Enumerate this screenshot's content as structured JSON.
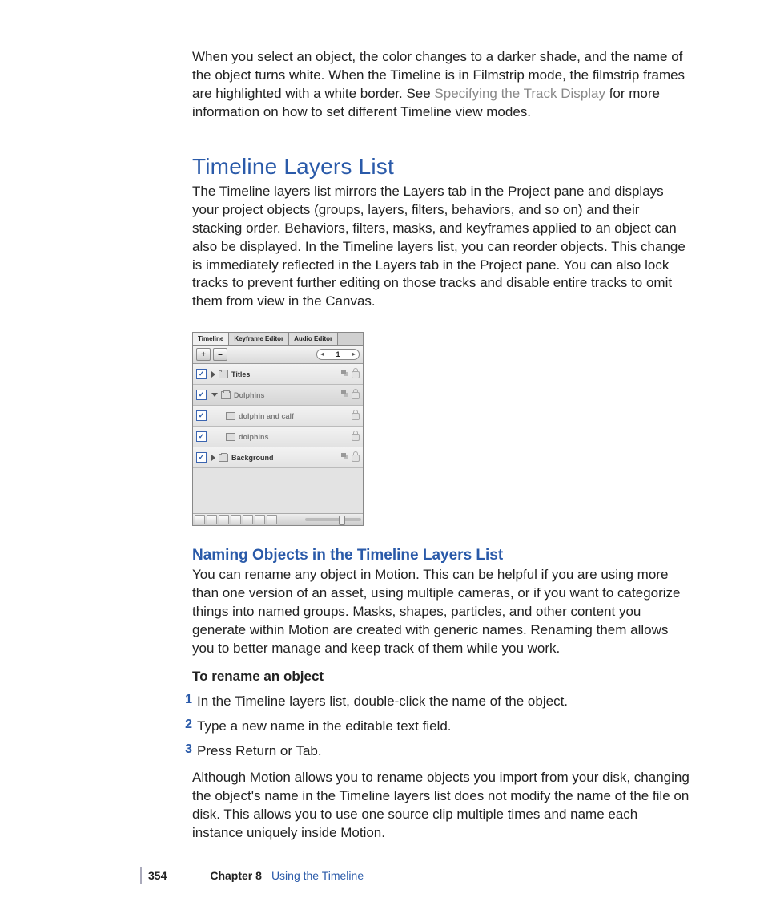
{
  "intro_para_pre": "When you select an object, the color changes to a darker shade, and the name of the object turns white. When the Timeline is in Filmstrip mode, the filmstrip frames are highlighted with a white border. See ",
  "intro_link": "Specifying the Track Display",
  "intro_para_post": " for more information on how to set different Timeline view modes.",
  "h1": "Timeline Layers List",
  "h1_para": "The Timeline layers list mirrors the Layers tab in the Project pane and displays your project objects (groups, layers, filters, behaviors, and so on) and their stacking order. Behaviors, filters, masks, and keyframes applied to an object can also be displayed. In the Timeline layers list, you can reorder objects. This change is immediately reflected in the Layers tab in the Project pane. You can also lock tracks to prevent further editing on those tracks and disable entire tracks to omit them from view in the Canvas.",
  "figure": {
    "tabs": [
      "Timeline",
      "Keyframe Editor",
      "Audio Editor"
    ],
    "plus": "+",
    "minus": "–",
    "pager_left": "◂",
    "pager_num": "1",
    "pager_right": "▸",
    "rows": [
      {
        "name": "Titles",
        "style": "bold",
        "tri": "right",
        "ico": "grp",
        "stack": true,
        "indent": 0
      },
      {
        "name": "Dolphins",
        "style": "dim",
        "tri": "down",
        "ico": "grp",
        "stack": true,
        "indent": 0
      },
      {
        "name": "dolphin and calf",
        "style": "dim",
        "tri": "",
        "ico": "lyr",
        "stack": false,
        "indent": 2
      },
      {
        "name": "dolphins",
        "style": "dim",
        "tri": "",
        "ico": "lyr",
        "stack": false,
        "indent": 2
      },
      {
        "name": "Background",
        "style": "bold",
        "tri": "right",
        "ico": "grp",
        "stack": true,
        "indent": 0
      }
    ]
  },
  "h2": "Naming Objects in the Timeline Layers List",
  "h2_para": "You can rename any object in Motion. This can be helpful if you are using more than one version of an asset, using multiple cameras, or if you want to categorize things into named groups. Masks, shapes, particles, and other content you generate within Motion are created with generic names. Renaming them allows you to better manage and keep track of them while you work.",
  "task_title": "To rename an object",
  "steps": [
    "In the Timeline layers list, double-click the name of the object.",
    "Type a new name in the editable text field.",
    "Press Return or Tab."
  ],
  "step_post_para": "Although Motion allows you to rename objects you import from your disk, changing the object's name in the Timeline layers list does not modify the name of the file on disk. This allows you to use one source clip multiple times and name each instance uniquely inside Motion.",
  "footer": {
    "page": "354",
    "chapter_label": "Chapter 8",
    "chapter_title": "Using the Timeline"
  }
}
